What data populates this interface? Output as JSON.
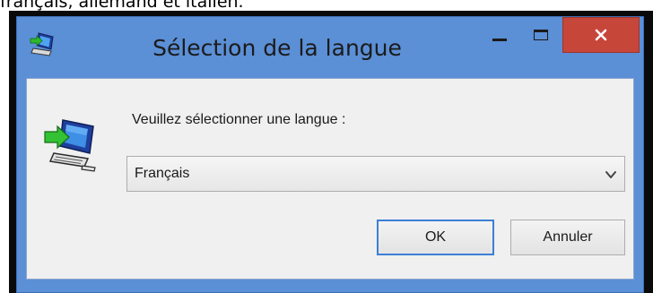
{
  "caption": {
    "text": "français, allemand et italien."
  },
  "window": {
    "title": "Sélection de la langue",
    "icon": "computer-arrow-icon",
    "controls": {
      "minimize": "minimize-icon",
      "maximize": "maximize-icon",
      "close": "×"
    }
  },
  "dialog": {
    "icon": "computer-arrow-icon",
    "prompt": "Veuillez sélectionner une langue :",
    "language_select": {
      "selected": "Français",
      "arrow": "chevron-down-icon"
    },
    "ok_label": "OK",
    "cancel_label": "Annuler"
  },
  "colors": {
    "titlebar": "#5b8fd6",
    "close_button": "#c7463a",
    "client_background": "#f0f0f0",
    "default_button_border": "#3c7fd6"
  }
}
